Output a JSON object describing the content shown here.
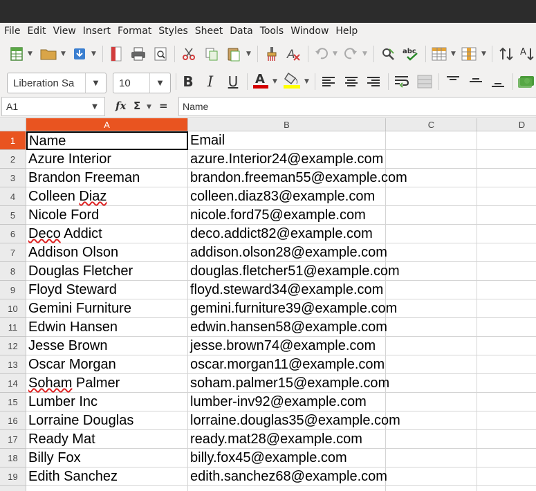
{
  "menu": [
    "File",
    "Edit",
    "View",
    "Insert",
    "Format",
    "Styles",
    "Sheet",
    "Data",
    "Tools",
    "Window",
    "Help"
  ],
  "toolbar": {
    "font_name": "Liberation Sa",
    "font_size": "10",
    "bold": "B",
    "italic": "I",
    "underline": "U",
    "font_color_glyph": "A",
    "spellcheck_glyph": "abc"
  },
  "formula_bar": {
    "cell_ref": "A1",
    "fx": "fx",
    "sigma": "Σ",
    "equals": "=",
    "content": "Name"
  },
  "columns": [
    "A",
    "B",
    "C",
    "D"
  ],
  "rows": [
    {
      "num": "1",
      "name": "Name",
      "email": "Email"
    },
    {
      "num": "2",
      "name": "Azure Interior",
      "email": "azure.Interior24@example.com"
    },
    {
      "num": "3",
      "name": "Brandon Freeman",
      "email": "brandon.freeman55@example.com"
    },
    {
      "num": "4",
      "name": "Colleen Diaz",
      "email": "colleen.diaz83@example.com"
    },
    {
      "num": "5",
      "name": "Nicole Ford",
      "email": "nicole.ford75@example.com"
    },
    {
      "num": "6",
      "name": "Deco Addict",
      "email": "deco.addict82@example.com"
    },
    {
      "num": "7",
      "name": "Addison Olson",
      "email": "addison.olson28@example.com"
    },
    {
      "num": "8",
      "name": "Douglas Fletcher",
      "email": "douglas.fletcher51@example.com"
    },
    {
      "num": "9",
      "name": "Floyd Steward",
      "email": "floyd.steward34@example.com"
    },
    {
      "num": "10",
      "name": "Gemini Furniture",
      "email": "gemini.furniture39@example.com"
    },
    {
      "num": "11",
      "name": "Edwin Hansen",
      "email": "edwin.hansen58@example.com"
    },
    {
      "num": "12",
      "name": "Jesse Brown",
      "email": "jesse.brown74@example.com"
    },
    {
      "num": "13",
      "name": "Oscar Morgan",
      "email": "oscar.morgan11@example.com"
    },
    {
      "num": "14",
      "name": "Soham Palmer",
      "email": "soham.palmer15@example.com"
    },
    {
      "num": "15",
      "name": "Lumber Inc",
      "email": "lumber-inv92@example.com"
    },
    {
      "num": "16",
      "name": "Lorraine Douglas",
      "email": "lorraine.douglas35@example.com"
    },
    {
      "num": "17",
      "name": "Ready Mat",
      "email": "ready.mat28@example.com"
    },
    {
      "num": "18",
      "name": "Billy Fox",
      "email": "billy.fox45@example.com"
    },
    {
      "num": "19",
      "name": "Edith Sanchez",
      "email": "edith.sanchez68@example.com"
    }
  ],
  "colors": {
    "accent": "#e95420",
    "titlebar": "#2c2c2c",
    "chrome": "#f2f1f0"
  }
}
